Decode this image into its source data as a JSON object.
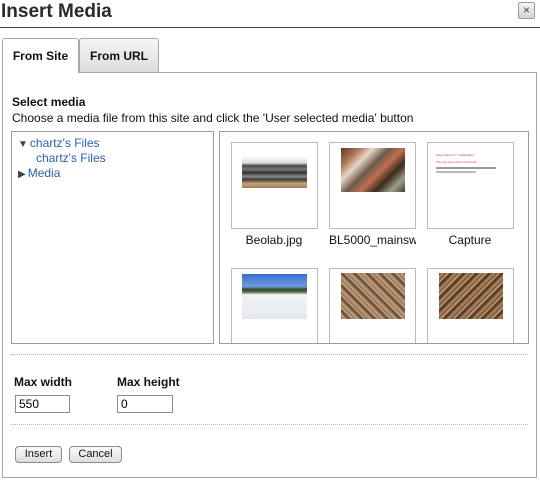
{
  "dialog": {
    "title": "Insert Media",
    "close_symbol": "×"
  },
  "tabs": [
    {
      "label": "From Site",
      "active": true
    },
    {
      "label": "From URL",
      "active": false
    }
  ],
  "select_media": {
    "heading": "Select media",
    "instructions": "Choose a media file from this site and click the 'User selected media' button"
  },
  "tree": [
    {
      "label": "chartz's Files",
      "expanded": true,
      "arrow": "▼"
    },
    {
      "label": "chartz's Files",
      "child": true
    },
    {
      "label": "Media",
      "expanded": false,
      "arrow": "▶"
    }
  ],
  "media_items": [
    {
      "label": "Beolab.jpg"
    },
    {
      "label": "BL5000_mainsw"
    },
    {
      "label": "Capture"
    },
    {
      "label": ""
    },
    {
      "label": ""
    },
    {
      "label": ""
    }
  ],
  "max_width": {
    "label": "Max width",
    "value": "550"
  },
  "max_height": {
    "label": "Max height",
    "value": "0"
  },
  "buttons": {
    "insert": "Insert",
    "cancel": "Cancel"
  },
  "capture_preview": {
    "heading": "Server Error in '/' Application.",
    "subheading": "The resource cannot be found."
  },
  "colors": {
    "link": "#2a5fb0",
    "border": "#a8a8a8"
  }
}
